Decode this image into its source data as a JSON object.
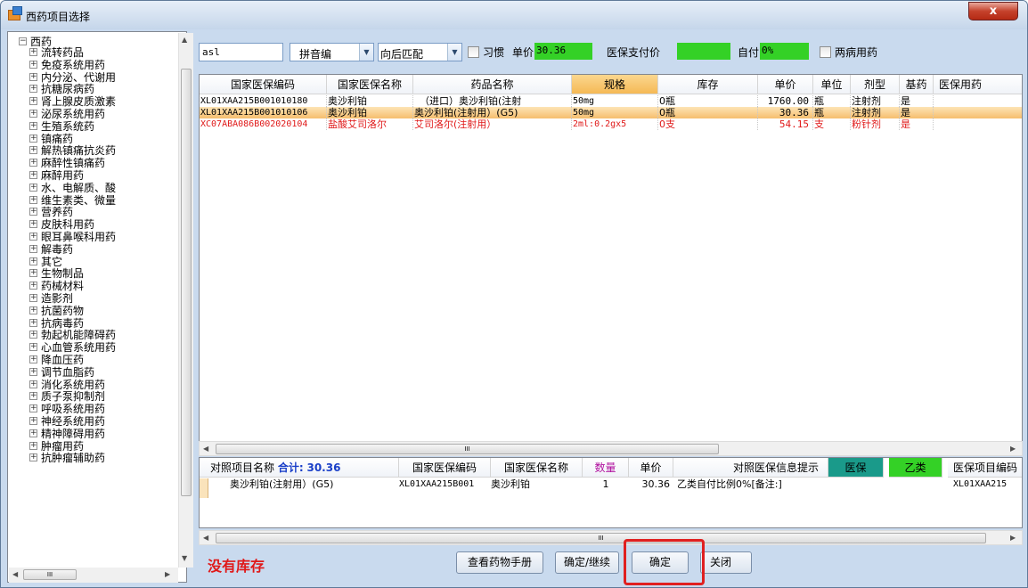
{
  "window": {
    "title": "西药项目选择",
    "close_label": "x"
  },
  "tree": {
    "root": "西药",
    "items": [
      "流转药品",
      "免疫系统用药",
      "内分泌、代谢用",
      "抗糖尿病药",
      "肾上腺皮质激素",
      "泌尿系统用药",
      "生殖系统药",
      "镇痛药",
      "解热镇痛抗炎药",
      "麻醉性镇痛药",
      "麻醉用药",
      "水、电解质、酸",
      "维生素类、微量",
      "营养药",
      "皮肤科用药",
      "眼耳鼻喉科用药",
      "解毒药",
      "其它",
      "生物制品",
      "药械材料",
      "造影剂",
      "抗菌药物",
      "抗病毒药",
      "勃起机能障碍药",
      "心血管系统用药",
      "降血压药",
      "调节血脂药",
      "消化系统用药",
      "质子泵抑制剂",
      "呼吸系统用药",
      "神经系统用药",
      "精神障碍用药",
      "肿瘤用药",
      "抗肿瘤辅助药"
    ],
    "hscroll_grip": "III"
  },
  "toolbar": {
    "search_value": "asl",
    "mode": "拼音编",
    "match": "向后匹配",
    "habit_label": "习惯",
    "price_label": "单价",
    "price_value": "30.36",
    "insurance_label": "医保支付价",
    "insurance_value": "",
    "self_pay_label": "自付",
    "self_pay_value": "0%",
    "two_disease_label": "两病用药"
  },
  "grid": {
    "headers": [
      "国家医保编码",
      "国家医保名称",
      "药品名称",
      "规格",
      "库存",
      "单价",
      "单位",
      "剂型",
      "基药",
      "医保用药"
    ],
    "rows": [
      {
        "code": "XL01XAA215B001010180",
        "name": "奥沙利铂",
        "drug": "（进口）奥沙利铂(注射",
        "spec": "50mg",
        "stock": "0瓶",
        "price": "1760.00",
        "unit": "瓶",
        "form": "注射剂",
        "basic": "是",
        "style": "normal"
      },
      {
        "code": "XL01XAA215B001010106",
        "name": "奥沙利铂",
        "drug": "奥沙利铂(注射用）(G5)",
        "spec": "50mg",
        "stock": "0瓶",
        "price": "30.36",
        "unit": "瓶",
        "form": "注射剂",
        "basic": "是",
        "style": "selected"
      },
      {
        "code": "XC07ABA086B002020104",
        "name": "盐酸艾司洛尔",
        "drug": "艾司洛尔(注射用）",
        "spec": "2ml:0.2gx5",
        "stock": "0支",
        "price": "54.15",
        "unit": "支",
        "form": "粉针剂",
        "basic": "是",
        "style": "red"
      }
    ],
    "hscroll_grip": "III"
  },
  "lower": {
    "headers": {
      "item": "对照项目名称",
      "total_label": "合计:",
      "total": "30.36",
      "code": "国家医保编码",
      "name": "国家医保名称",
      "qty": "数量",
      "price": "单价",
      "tip": "对照医保信息提示",
      "ins": "医保",
      "cls": "乙类",
      "code2": "医保项目编码"
    },
    "rows": [
      {
        "item": "奥沙利铂(注射用）(G5)",
        "code": "XL01XAA215B001",
        "name": "奥沙利铂",
        "qty": "1",
        "price": "30.36",
        "tip": "乙类自付比例0%[备注:]",
        "code2": "XL01XAA215"
      }
    ],
    "hscroll_grip": "III"
  },
  "bottom": {
    "no_stock": "没有库存",
    "manual": "查看药物手册",
    "confirm_continue": "确定/继续",
    "confirm": "确定",
    "close": "关闭"
  }
}
